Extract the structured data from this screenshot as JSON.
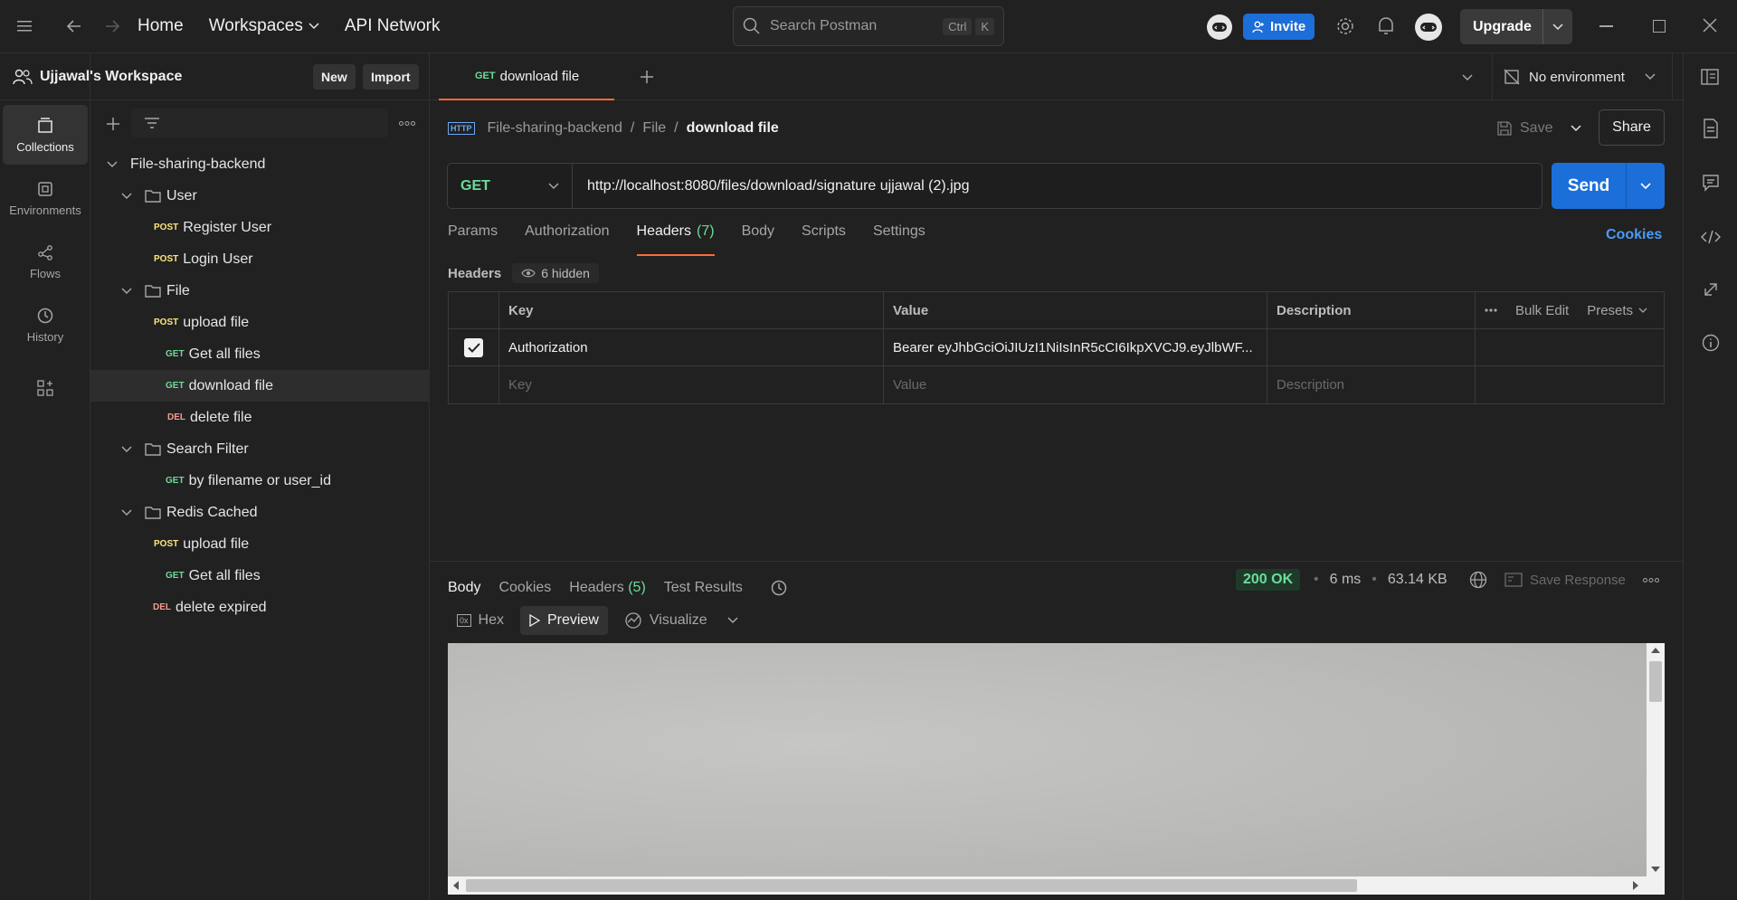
{
  "topbar": {
    "home": "Home",
    "workspaces": "Workspaces",
    "api_network": "API Network",
    "search_placeholder": "Search Postman",
    "kbd_ctrl": "Ctrl",
    "kbd_k": "K",
    "invite": "Invite",
    "upgrade": "Upgrade"
  },
  "workspace": {
    "name": "Ujjawal's Workspace",
    "new_label": "New",
    "import_label": "Import"
  },
  "rail": {
    "collections": "Collections",
    "environments": "Environments",
    "flows": "Flows",
    "history": "History"
  },
  "tree": {
    "collection": "File-sharing-backend",
    "items": [
      {
        "type": "folder",
        "label": "User"
      },
      {
        "type": "request",
        "method": "POST",
        "label": "Register User"
      },
      {
        "type": "request",
        "method": "POST",
        "label": "Login User"
      },
      {
        "type": "folder",
        "label": "File"
      },
      {
        "type": "request",
        "method": "POST",
        "label": "upload file"
      },
      {
        "type": "request",
        "method": "GET",
        "label": "Get all files"
      },
      {
        "type": "request",
        "method": "GET",
        "label": "download file"
      },
      {
        "type": "request",
        "method": "DEL",
        "label": "delete file"
      },
      {
        "type": "folder",
        "label": "Search Filter"
      },
      {
        "type": "request",
        "method": "GET",
        "label": "by filename or user_id"
      },
      {
        "type": "folder",
        "label": "Redis Cached"
      },
      {
        "type": "request",
        "method": "POST",
        "label": "upload file"
      },
      {
        "type": "request",
        "method": "GET",
        "label": "Get all files"
      },
      {
        "type": "request",
        "method": "DEL",
        "label": "delete expired"
      }
    ]
  },
  "tab": {
    "method": "GET",
    "name": "download file",
    "environment": "No environment"
  },
  "breadcrumb": {
    "collection": "File-sharing-backend",
    "folder": "File",
    "request": "download file",
    "save": "Save",
    "share": "Share"
  },
  "request": {
    "method": "GET",
    "url": "http://localhost:8080/files/download/signature ujjawal (2).jpg",
    "send": "Send",
    "tabs": [
      "Params",
      "Authorization",
      "Headers",
      "Body",
      "Scripts",
      "Settings"
    ],
    "headers_count": "(7)",
    "cookies": "Cookies"
  },
  "headers": {
    "label": "Headers",
    "hidden": "6 hidden",
    "col_key": "Key",
    "col_value": "Value",
    "col_description": "Description",
    "bulk_edit": "Bulk Edit",
    "presets": "Presets",
    "row_key": "Authorization",
    "row_value": "Bearer eyJhbGciOiJIUzI1NiIsInR5cCI6IkpXVCJ9.eyJlbWF...",
    "placeholder_key": "Key",
    "placeholder_value": "Value",
    "placeholder_description": "Description"
  },
  "response": {
    "tabs": {
      "body": "Body",
      "cookies": "Cookies",
      "headers": "Headers",
      "headers_count": "(5)",
      "tests": "Test Results"
    },
    "status": "200 OK",
    "time": "6 ms",
    "size": "63.14 KB",
    "save_response": "Save Response",
    "formats": {
      "hex": "Hex",
      "preview": "Preview",
      "visualize": "Visualize"
    }
  },
  "colors": {
    "accent": "#ff6c37",
    "primary": "#1c6ed9",
    "get": "#6bdd9a",
    "post": "#ffe47e",
    "del": "#f79a8e"
  }
}
